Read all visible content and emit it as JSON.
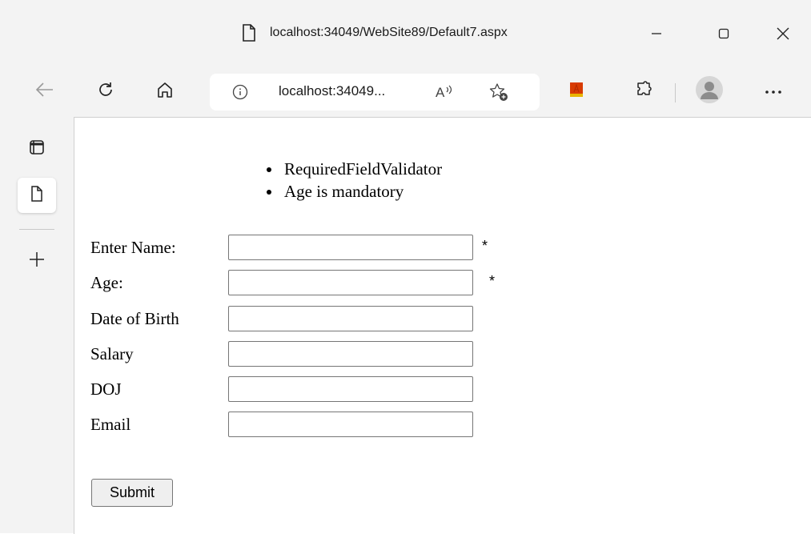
{
  "window": {
    "title": "localhost:34049/WebSite89/Default7.aspx"
  },
  "toolbar": {
    "address_text": "localhost:34049...",
    "read_aloud_label": "A⁾"
  },
  "page": {
    "errors": [
      "RequiredFieldValidator",
      "Age is mandatory"
    ],
    "fields": [
      {
        "label": "Enter Name:",
        "value": "",
        "required_marker": "*"
      },
      {
        "label": "Age:",
        "value": "",
        "required_marker": "*"
      },
      {
        "label": "Date of Birth",
        "value": "",
        "required_marker": ""
      },
      {
        "label": "Salary",
        "value": "",
        "required_marker": ""
      },
      {
        "label": "DOJ",
        "value": "",
        "required_marker": ""
      },
      {
        "label": "Email",
        "value": "",
        "required_marker": ""
      }
    ],
    "submit_label": "Submit"
  },
  "colors": {
    "chrome_bg": "#f3f3f3",
    "collections_icon": "#d83b01"
  }
}
